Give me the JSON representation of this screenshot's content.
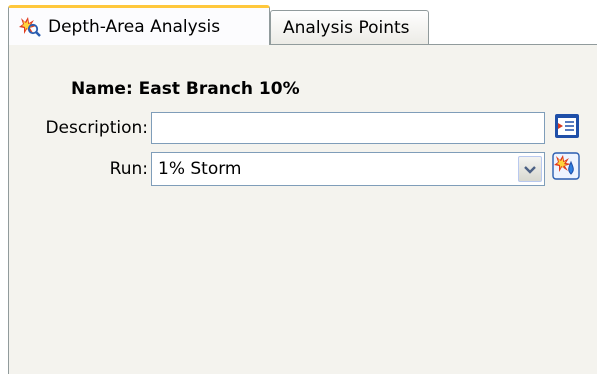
{
  "tabs": [
    {
      "label": "Depth-Area Analysis",
      "active": true,
      "icon": "depth-area-analysis-icon"
    },
    {
      "label": "Analysis Points",
      "active": false
    }
  ],
  "form": {
    "name_label": "Name:",
    "name_value": "East Branch 10%",
    "description_label": "Description:",
    "description_value": "",
    "run_label": "Run:",
    "run_value": "1% Storm"
  },
  "icons": {
    "description_button": "edit-description-icon",
    "run_button": "compute-run-icon",
    "dropdown": "chevron-down-icon"
  },
  "colors": {
    "active_tab_accent": "#ffc83c",
    "panel_background": "#f4f3ee",
    "field_border": "#7f9db9"
  }
}
